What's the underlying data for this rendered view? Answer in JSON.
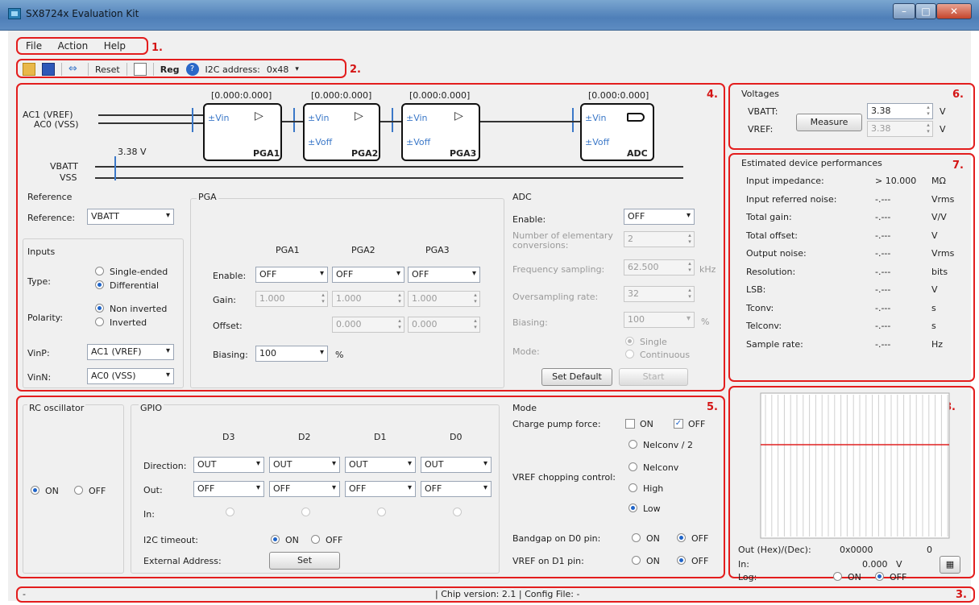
{
  "window": {
    "title": "SX8724x Evaluation Kit",
    "min": "–",
    "max": "□",
    "close": "✕"
  },
  "menu": {
    "items": [
      "File",
      "Action",
      "Help"
    ]
  },
  "toolbar": {
    "reset": "Reset",
    "reg": "Reg",
    "i2c_label": "I2C address:",
    "i2c_value": "0x48"
  },
  "callouts": [
    "1.",
    "2.",
    "3.",
    "4.",
    "5.",
    "6.",
    "7.",
    "8."
  ],
  "diagram": {
    "ranges": [
      "[0.000:0.000]",
      "[0.000:0.000]",
      "[0.000:0.000]",
      "[0.000:0.000]"
    ],
    "ac1": "AC1 (VREF)",
    "ac0": "AC0 (VSS)",
    "vbatt": "VBATT",
    "vss": "VSS",
    "vbatt_value": "3.38 V",
    "vin": "±Vin",
    "voff": "±Voff",
    "amp": "▷",
    "blocks": [
      "PGA1",
      "PGA2",
      "PGA3",
      "ADC"
    ]
  },
  "reference": {
    "title": "Reference",
    "label": "Reference:",
    "value": "VBATT"
  },
  "inputs": {
    "title": "Inputs",
    "type_label": "Type:",
    "type_opts": [
      "Single-ended",
      "Differential"
    ],
    "polarity_label": "Polarity:",
    "polarity_opts": [
      "Non inverted",
      "Inverted"
    ],
    "vinp_label": "VinP:",
    "vinp_value": "AC1 (VREF)",
    "vinn_label": "VinN:",
    "vinn_value": "AC0 (VSS)"
  },
  "pga": {
    "title": "PGA",
    "cols": [
      "PGA1",
      "PGA2",
      "PGA3"
    ],
    "enable_label": "Enable:",
    "enable_values": [
      "OFF",
      "OFF",
      "OFF"
    ],
    "gain_label": "Gain:",
    "gain_values": [
      "1.000",
      "1.000",
      "1.000"
    ],
    "offset_label": "Offset:",
    "offset_values": [
      "0.000",
      "0.000"
    ],
    "biasing_label": "Biasing:",
    "biasing_value": "100",
    "pct": "%"
  },
  "adc": {
    "title": "ADC",
    "enable_label": "Enable:",
    "enable_value": "OFF",
    "num_conv_label": "Number of elementary",
    "num_conv_label2": "conversions:",
    "num_conv_value": "2",
    "freq_label": "Frequency sampling:",
    "freq_value": "62.500",
    "freq_unit": "kHz",
    "osr_label": "Oversampling rate:",
    "osr_value": "32",
    "bias_label": "Biasing:",
    "bias_value": "100",
    "bias_unit": "%",
    "mode_label": "Mode:",
    "mode_opts": [
      "Single",
      "Continuous"
    ],
    "set_default": "Set Default",
    "start": "Start"
  },
  "voltages": {
    "title": "Voltages",
    "vbatt_label": "VBATT:",
    "vref_label": "VREF:",
    "measure": "Measure",
    "vbatt_value": "3.38",
    "vref_value": "3.38",
    "unit": "V"
  },
  "perf": {
    "title": "Estimated device performances",
    "rows": [
      {
        "label": "Input impedance:",
        "value": "> 10.000",
        "unit": "MΩ"
      },
      {
        "label": "Input referred noise:",
        "value": "-.---",
        "unit": "Vrms"
      },
      {
        "label": "Total gain:",
        "value": "-.---",
        "unit": "V/V"
      },
      {
        "label": "Total offset:",
        "value": "-.---",
        "unit": "V"
      },
      {
        "label": "Output noise:",
        "value": "-.---",
        "unit": "Vrms"
      },
      {
        "label": "Resolution:",
        "value": "-.---",
        "unit": "bits"
      },
      {
        "label": "LSB:",
        "value": "-.---",
        "unit": "V"
      },
      {
        "label": "Tconv:",
        "value": "-.---",
        "unit": "s"
      },
      {
        "label": "Telconv:",
        "value": "-.---",
        "unit": "s"
      },
      {
        "label": "Sample rate:",
        "value": "-.---",
        "unit": "Hz"
      }
    ]
  },
  "rc": {
    "title": "RC oscillator",
    "on": "ON",
    "off": "OFF"
  },
  "gpio": {
    "title": "GPIO",
    "cols": [
      "D3",
      "D2",
      "D1",
      "D0"
    ],
    "direction_label": "Direction:",
    "direction_values": [
      "OUT",
      "OUT",
      "OUT",
      "OUT"
    ],
    "out_label": "Out:",
    "out_values": [
      "OFF",
      "OFF",
      "OFF",
      "OFF"
    ],
    "in_label": "In:",
    "i2c_timeout_label": "I2C timeout:",
    "on": "ON",
    "off": "OFF",
    "ext_addr_label": "External Address:",
    "set": "Set"
  },
  "mode": {
    "title": "Mode",
    "cp_label": "Charge pump force:",
    "on": "ON",
    "off": "OFF",
    "vref_chop_label": "VREF chopping control:",
    "vref_chop_opts": [
      "Nelconv / 2",
      "Nelconv",
      "High",
      "Low"
    ],
    "bandgap_label": "Bandgap on D0 pin:",
    "vref_d1_label": "VREF on D1 pin:"
  },
  "plot": {
    "out_label": "Out (Hex)/(Dec):",
    "out_hex": "0x0000",
    "out_dec": "0",
    "in_label": "In:",
    "in_value": "0.000",
    "in_unit": "V",
    "log_label": "Log:",
    "on": "ON",
    "off": "OFF",
    "line_color": "#e02020"
  },
  "status": {
    "left": "-",
    "text": "| Chip version: 2.1 | Config File: -"
  }
}
